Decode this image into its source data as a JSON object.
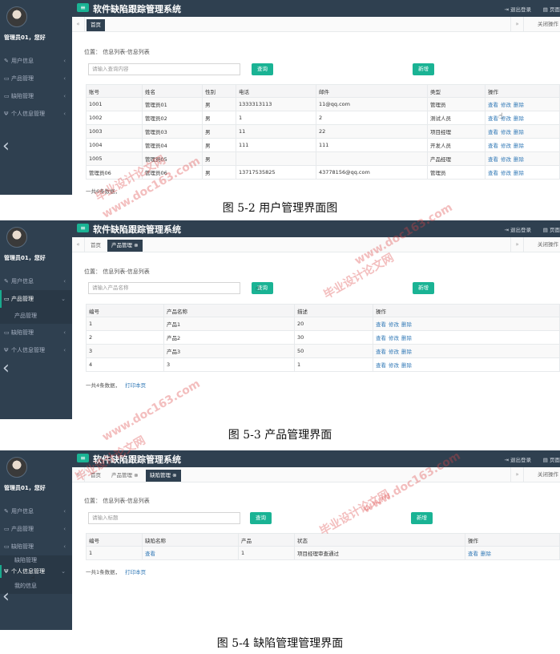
{
  "app": {
    "title": "软件缺陷跟踪管理系统",
    "logout": "退出登录",
    "page": "页面",
    "close_ops": "关闭操作",
    "user_greeting": "管理员01，您好"
  },
  "menu": {
    "user": "用户信息",
    "product": "产品管理",
    "defect": "缺陷管理",
    "personal": "个人信息管理",
    "product_sub": "产品管理",
    "defect_sub": "缺陷管理",
    "my_info": "我的信息"
  },
  "tabs": {
    "home": "首页",
    "product": "产品管理",
    "defect": "缺陷管理"
  },
  "crumb": "位置： 信息列表-信息列表",
  "buttons": {
    "query": "查询",
    "add": "新增"
  },
  "ops": {
    "view": "查看",
    "edit": "修改",
    "delete": "删除"
  },
  "print": "打印本页",
  "shot1": {
    "placeholder": "请输入查询内容",
    "headers": [
      "账号",
      "姓名",
      "性别",
      "电话",
      "邮件",
      "类型",
      "操作"
    ],
    "rows": [
      [
        "1001",
        "管理员01",
        "男",
        "1333313113",
        "11@qq.com",
        "管理员"
      ],
      [
        "1002",
        "管理员02",
        "男",
        "1",
        "2",
        "测试人员"
      ],
      [
        "1003",
        "管理员03",
        "男",
        "11",
        "22",
        "项目经理"
      ],
      [
        "1004",
        "管理员04",
        "男",
        "111",
        "111",
        "开发人员"
      ],
      [
        "1005",
        "管理员05",
        "男",
        "",
        "",
        "产品经理"
      ],
      [
        "管理员06",
        "管理员06",
        "男",
        "13717535825",
        "43778156@qq.com",
        "管理员"
      ]
    ],
    "count": "一共6条数据，",
    "caption": "图 5-2 用户管理界面图"
  },
  "shot2": {
    "placeholder": "请输入产品名称",
    "headers": [
      "编号",
      "产品名称",
      "描述",
      "操作"
    ],
    "rows": [
      [
        "1",
        "产品1",
        "20"
      ],
      [
        "2",
        "产品2",
        "30"
      ],
      [
        "3",
        "产品3",
        "50"
      ],
      [
        "4",
        "3",
        "1"
      ]
    ],
    "count": "一共4条数据，",
    "caption": "图 5-3 产品管理界面"
  },
  "shot3": {
    "placeholder": "请输入标题",
    "headers": [
      "编号",
      "缺陷名称",
      "产品",
      "状态",
      "操作"
    ],
    "rows": [
      [
        "1",
        "查看",
        "1",
        "项目经理审查通过"
      ]
    ],
    "count": "一共1条数据，",
    "caption": "图 5-4 缺陷管理管理界面"
  },
  "watermarks": {
    "cn": "毕业设计论文网",
    "url": "www.doc163.com"
  },
  "colors": {
    "sidebar": "#2f4050",
    "accent": "#1ab394",
    "link": "#337ab7",
    "status": "#d9534f"
  }
}
